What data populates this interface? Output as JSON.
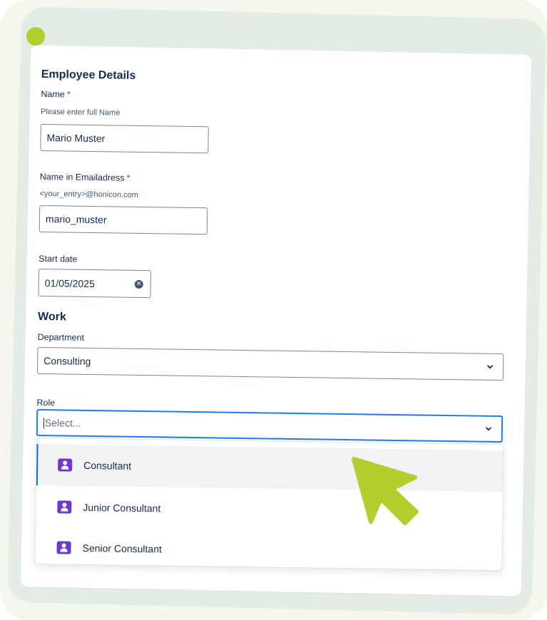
{
  "form": {
    "section_employee": "Employee Details",
    "name_label": "Name",
    "required_mark": "*",
    "name_helper": "Please enter full Name",
    "name_value": "Mario Muster",
    "email_label": "Name in Emailadress",
    "email_helper": "<your_entry>@honicon.com",
    "email_value": "mario_muster",
    "start_label": "Start date",
    "start_value": "01/05/2025",
    "section_work": "Work",
    "department_label": "Department",
    "department_value": "Consulting",
    "role_label": "Role",
    "role_placeholder": "Select...",
    "role_options": [
      {
        "label": "Consultant",
        "icon": "person-badge-icon",
        "selected": true
      },
      {
        "label": "Junior Consultant",
        "icon": "person-badge-icon",
        "selected": false
      },
      {
        "label": "Senior Consultant",
        "icon": "person-badge-icon",
        "selected": false
      }
    ]
  },
  "colors": {
    "accent": "#b3cf2e",
    "focus": "#1d7afc",
    "option_icon": "#6e3bc8",
    "required": "#de350b"
  }
}
